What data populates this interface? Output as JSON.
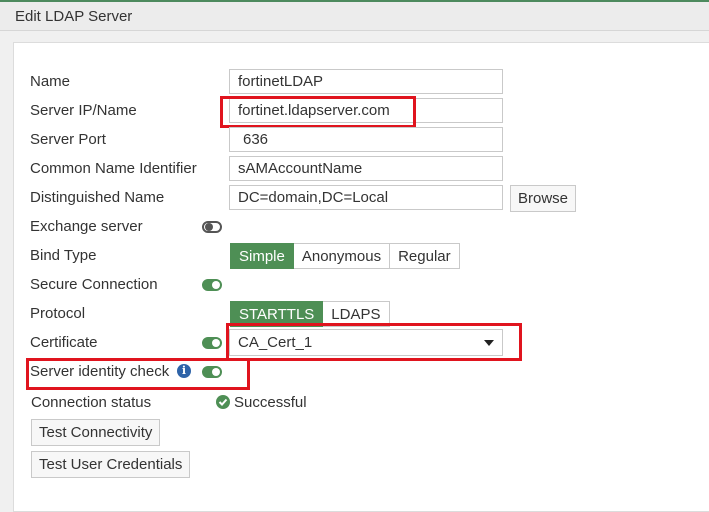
{
  "window": {
    "title": "Edit LDAP Server"
  },
  "form": {
    "name": {
      "label": "Name",
      "value": "fortinetLDAP"
    },
    "server_ip": {
      "label": "Server IP/Name",
      "value": "fortinet.ldapserver.com"
    },
    "server_port": {
      "label": "Server Port",
      "value": "636"
    },
    "common_name": {
      "label": "Common Name Identifier",
      "value": "sAMAccountName"
    },
    "distinguished_name": {
      "label": "Distinguished Name",
      "value": "DC=domain,DC=Local",
      "browse_label": "Browse"
    },
    "exchange_server": {
      "label": "Exchange server",
      "enabled": false
    },
    "bind_type": {
      "label": "Bind Type",
      "options": [
        "Simple",
        "Anonymous",
        "Regular"
      ],
      "selected": "Simple"
    },
    "secure_connection": {
      "label": "Secure Connection",
      "enabled": true
    },
    "protocol": {
      "label": "Protocol",
      "options": [
        "STARTTLS",
        "LDAPS"
      ],
      "selected": "STARTTLS"
    },
    "certificate": {
      "label": "Certificate",
      "enabled": true,
      "value": "CA_Cert_1"
    },
    "server_identity_check": {
      "label": "Server identity check",
      "enabled": true,
      "info_icon": "info-icon"
    },
    "connection_status": {
      "label": "Connection status",
      "value": "Successful",
      "icon": "check-circle-icon"
    }
  },
  "actions": {
    "test_connectivity": "Test Connectivity",
    "test_user_credentials": "Test User Credentials"
  },
  "colors": {
    "accent": "#4e8f55",
    "highlight": "#e0141e",
    "info": "#2e63a8"
  }
}
